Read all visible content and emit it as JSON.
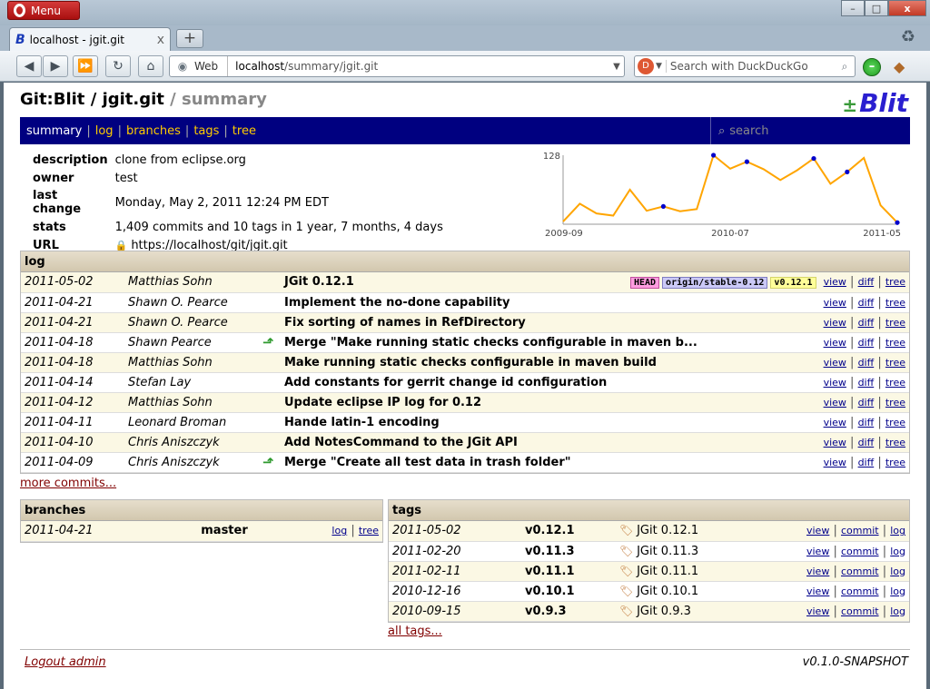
{
  "browser": {
    "menu_label": "Menu",
    "tab_title": "localhost - jgit.git",
    "tab_close": "x",
    "new_tab": "+",
    "address_prefix": "Web",
    "address_host": "localhost",
    "address_path": "/summary/jgit.git",
    "search_placeholder": "Search with DuckDuckGo",
    "window_controls": {
      "minimize": "–",
      "maximize": "□",
      "close": "x"
    }
  },
  "header": {
    "brand": "Git:Blit",
    "repo": "jgit.git",
    "page": "summary",
    "sep": "/",
    "logo": "Blit"
  },
  "nav": {
    "items": [
      "summary",
      "log",
      "branches",
      "tags",
      "tree"
    ],
    "separator": "|",
    "search_placeholder": "search"
  },
  "info": [
    {
      "key": "description",
      "value": "clone from eclipse.org"
    },
    {
      "key": "owner",
      "value": "test"
    },
    {
      "key": "last change",
      "value": "Monday, May 2, 2011 12:24 PM EDT"
    },
    {
      "key": "stats",
      "value": "1,409 commits and 10 tags in 1 year, 7 months, 4 days"
    },
    {
      "key": "URL",
      "value": "https://localhost/git/jgit.git"
    }
  ],
  "chart_data": {
    "type": "line",
    "ymax_label": "128",
    "x_ticks": [
      "2009-09",
      "2010-07",
      "2011-05"
    ],
    "values": [
      5,
      38,
      20,
      16,
      64,
      25,
      33,
      24,
      28,
      128,
      103,
      116,
      102,
      82,
      100,
      122,
      75,
      97,
      123,
      35,
      3
    ],
    "marked_points": [
      6,
      9,
      11,
      15,
      17,
      20
    ],
    "colors": {
      "line": "#ffa500",
      "point": "#0000cc",
      "axis": "#999999"
    }
  },
  "log": {
    "title": "log",
    "commits": [
      {
        "date": "2011-05-02",
        "author": "Matthias Sohn",
        "merge": false,
        "message": "JGit 0.12.1",
        "refs": [
          {
            "label": "HEAD",
            "kind": "head"
          },
          {
            "label": "origin/stable-0.12",
            "kind": "rem"
          },
          {
            "label": "v0.12.1",
            "kind": "tag"
          }
        ]
      },
      {
        "date": "2011-04-21",
        "author": "Shawn O. Pearce",
        "merge": false,
        "message": "Implement the no-done capability",
        "refs": []
      },
      {
        "date": "2011-04-21",
        "author": "Shawn O. Pearce",
        "merge": false,
        "message": "Fix sorting of names in RefDirectory",
        "refs": []
      },
      {
        "date": "2011-04-18",
        "author": "Shawn Pearce",
        "merge": true,
        "message": "Merge \"Make running static checks configurable in maven b...",
        "refs": []
      },
      {
        "date": "2011-04-18",
        "author": "Matthias Sohn",
        "merge": false,
        "message": "Make running static checks configurable in maven build",
        "refs": []
      },
      {
        "date": "2011-04-14",
        "author": "Stefan Lay",
        "merge": false,
        "message": "Add constants for gerrit change id configuration",
        "refs": []
      },
      {
        "date": "2011-04-12",
        "author": "Matthias Sohn",
        "merge": false,
        "message": "Update eclipse IP log for 0.12",
        "refs": []
      },
      {
        "date": "2011-04-11",
        "author": "Leonard Broman",
        "merge": false,
        "message": "Hande latin-1 encoding",
        "refs": []
      },
      {
        "date": "2011-04-10",
        "author": "Chris Aniszczyk",
        "merge": false,
        "message": "Add NotesCommand to the JGit API",
        "refs": []
      },
      {
        "date": "2011-04-09",
        "author": "Chris Aniszczyk",
        "merge": true,
        "message": "Merge \"Create all test data in trash folder\"",
        "refs": []
      }
    ],
    "actions": [
      "view",
      "diff",
      "tree"
    ],
    "more_label": "more commits..."
  },
  "branches": {
    "title": "branches",
    "items": [
      {
        "date": "2011-04-21",
        "name": "master"
      }
    ],
    "actions": [
      "log",
      "tree"
    ]
  },
  "tags": {
    "title": "tags",
    "items": [
      {
        "date": "2011-05-02",
        "name": "v0.12.1",
        "message": "JGit 0.12.1"
      },
      {
        "date": "2011-02-20",
        "name": "v0.11.3",
        "message": "JGit 0.11.3"
      },
      {
        "date": "2011-02-11",
        "name": "v0.11.1",
        "message": "JGit 0.11.1"
      },
      {
        "date": "2010-12-16",
        "name": "v0.10.1",
        "message": "JGit 0.10.1"
      },
      {
        "date": "2010-09-15",
        "name": "v0.9.3",
        "message": "JGit 0.9.3"
      }
    ],
    "actions": [
      "view",
      "commit",
      "log"
    ],
    "more_label": "all tags..."
  },
  "footer": {
    "logout": "Logout admin",
    "version": "v0.1.0-SNAPSHOT"
  }
}
